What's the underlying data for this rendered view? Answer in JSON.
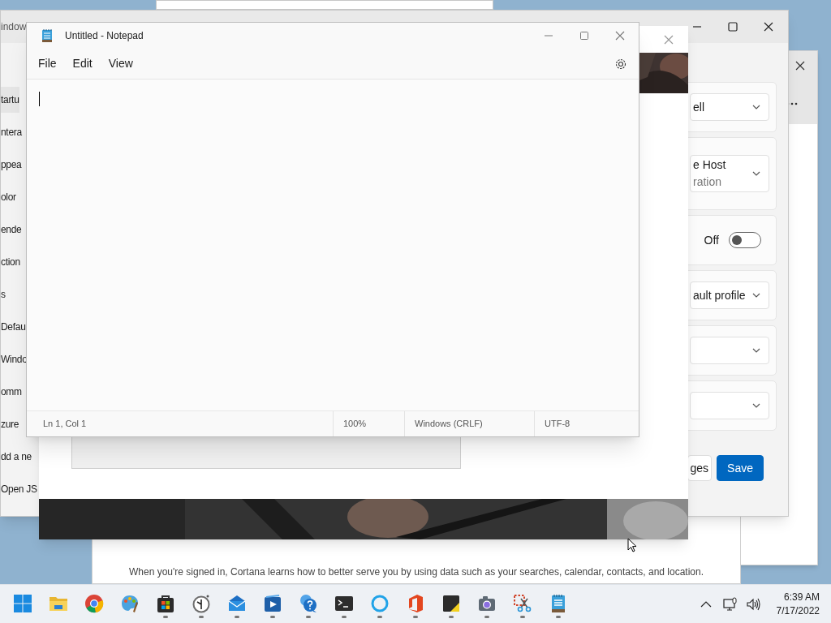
{
  "terminal_settings_window": {
    "title": "indow",
    "nav_items": [
      {
        "label": "tartu",
        "selected": true
      },
      {
        "label": "ntera",
        "selected": false
      },
      {
        "label": "ppea",
        "selected": false
      },
      {
        "label": "olor",
        "selected": false
      },
      {
        "label": "ende",
        "selected": false
      },
      {
        "label": "ction",
        "selected": false
      },
      {
        "label": "s",
        "selected": false
      },
      {
        "label": "Defau",
        "selected": false
      },
      {
        "label": "Windo",
        "selected": false
      },
      {
        "label": "omm",
        "selected": false
      },
      {
        "label": "zure",
        "selected": false
      },
      {
        "label": "dd a ne",
        "selected": false
      },
      {
        "label": "Open JS",
        "selected": false
      }
    ],
    "settings_rows": [
      {
        "kind": "dropdown",
        "value": "ell"
      },
      {
        "kind": "dropdown",
        "value": "e Host",
        "subtitle": "ration"
      },
      {
        "kind": "toggle",
        "state_label": "Off",
        "on": false
      },
      {
        "kind": "dropdown",
        "value": "ault profile"
      },
      {
        "kind": "dropdown"
      },
      {
        "kind": "dropdown"
      }
    ],
    "buttons": [
      {
        "label": "ges",
        "kind": "secondary"
      },
      {
        "label": "Save",
        "kind": "primary"
      }
    ]
  },
  "cortana_window": {
    "notice": "When you're signed in, Cortana learns how to better serve you by using data such as your searches, calendar, contacts, and location."
  },
  "notepad": {
    "title": "Untitled - Notepad",
    "menu": [
      "File",
      "Edit",
      "View"
    ],
    "status_bar": [
      "Ln 1, Col 1",
      "100%",
      "Windows (CRLF)",
      "UTF-8"
    ]
  },
  "taskbar": {
    "apps": [
      {
        "kind": "start",
        "running": false
      },
      {
        "kind": "folder",
        "running": false
      },
      {
        "kind": "browser",
        "running": false
      },
      {
        "kind": "palette",
        "running": false
      },
      {
        "kind": "store",
        "running": true
      },
      {
        "kind": "clock",
        "running": true
      },
      {
        "kind": "mail",
        "running": true
      },
      {
        "kind": "video",
        "running": true
      },
      {
        "kind": "help",
        "running": true
      },
      {
        "kind": "terminal",
        "running": true
      },
      {
        "kind": "ring",
        "running": true
      },
      {
        "kind": "office",
        "running": true
      },
      {
        "kind": "sticky",
        "running": true
      },
      {
        "kind": "camera",
        "running": true
      },
      {
        "kind": "snip",
        "running": true
      },
      {
        "kind": "notepad",
        "running": true
      }
    ],
    "clock": {
      "time": "6:39 AM",
      "date": "7/17/2022"
    }
  }
}
